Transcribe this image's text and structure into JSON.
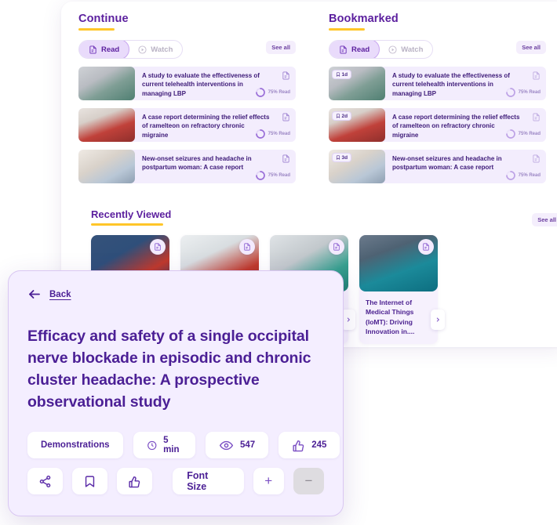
{
  "sections": {
    "continue": {
      "title": "Continue",
      "toggle": {
        "read": "Read",
        "watch": "Watch"
      },
      "see_all": "See all",
      "items": [
        {
          "title": "A study to evaluate the effectiveness of current telehealth interventions in managing LBP",
          "progress": "75% Read",
          "badge": ""
        },
        {
          "title": "A case report determining the relief effects of ramelteon on refractory chronic migraine",
          "progress": "75% Read",
          "badge": ""
        },
        {
          "title": "New-onset seizures and headache in postpartum woman: A case report",
          "progress": "75% Read",
          "badge": ""
        }
      ]
    },
    "bookmarked": {
      "title": "Bookmarked",
      "toggle": {
        "read": "Read",
        "watch": "Watch"
      },
      "see_all": "See all",
      "items": [
        {
          "title": "A study to evaluate the effectiveness of current telehealth interventions in managing LBP",
          "progress": "75% Read",
          "badge": "1d"
        },
        {
          "title": "A case report determining the relief effects of ramelteon on refractory chronic migraine",
          "progress": "75% Read",
          "badge": "2d"
        },
        {
          "title": "New-onset seizures and headache in postpartum woman: A case report",
          "progress": "75% Read",
          "badge": "3d"
        }
      ]
    },
    "recently_viewed": {
      "title": "Recently Viewed",
      "see_all": "See all",
      "cards": [
        {
          "title": ""
        },
        {
          "title": ""
        },
        {
          "title": ""
        },
        {
          "title": "The Internet of Medical Things (IoMT): Driving Innovation in...."
        }
      ]
    }
  },
  "overlay": {
    "back_label": "Back",
    "title": "Efficacy and safety of a single occipital nerve blockade in episodic and chronic cluster headache: A prospective observational study",
    "meta": {
      "category": "Demonstrations",
      "duration": "5 min",
      "views": "547",
      "likes": "245"
    },
    "actions": {
      "font_size_label": "Font Size",
      "increase": "+",
      "decrease": "−"
    }
  },
  "colors": {
    "accent_purple": "#5b1f9e",
    "accent_yellow": "#ffc629",
    "panel_lavender": "#f4eeff",
    "row_lavender": "#f3edfd"
  }
}
